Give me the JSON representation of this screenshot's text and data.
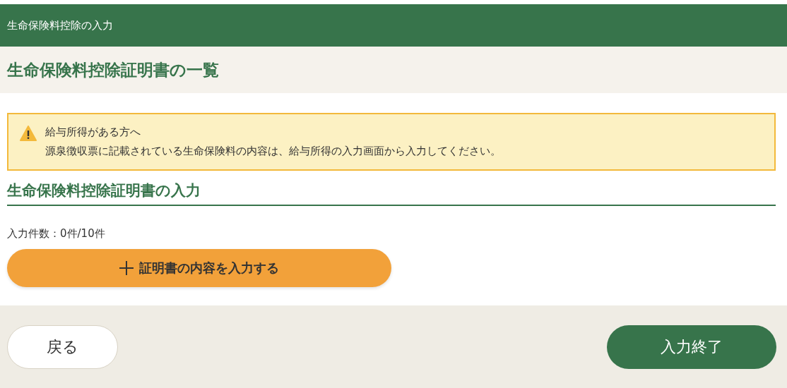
{
  "header": {
    "title": "生命保険料控除の入力"
  },
  "page_title": "生命保険料控除証明書の一覧",
  "notice": {
    "title": "給与所得がある方へ",
    "text": "源泉徴収票に記載されている生命保険料の内容は、給与所得の入力画面から入力してください。"
  },
  "section": {
    "title": "生命保険料控除証明書の入力",
    "count": "入力件数：0件/10件",
    "add_button": "証明書の内容を入力する"
  },
  "footer": {
    "back_button": "戻る",
    "finish_button": "入力終了"
  }
}
